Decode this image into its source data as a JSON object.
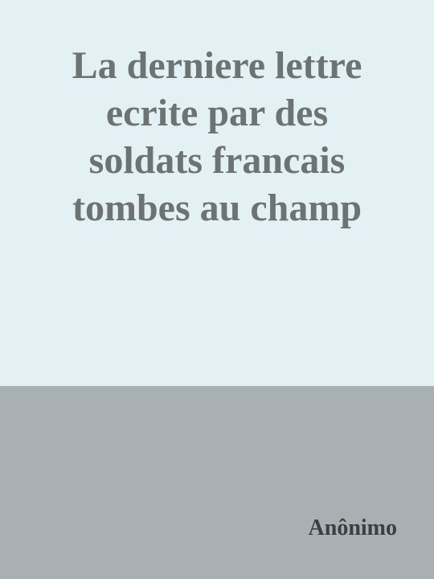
{
  "cover": {
    "title_lines": [
      "La derniere lettre",
      "ecrite par des",
      "soldats francais",
      "tombes au champ"
    ],
    "author": "Anônimo"
  },
  "colors": {
    "top_background": "#e3f0f4",
    "bottom_background": "#a9b0b3",
    "title_text": "#6d7372",
    "author_text": "#3b3f40"
  }
}
